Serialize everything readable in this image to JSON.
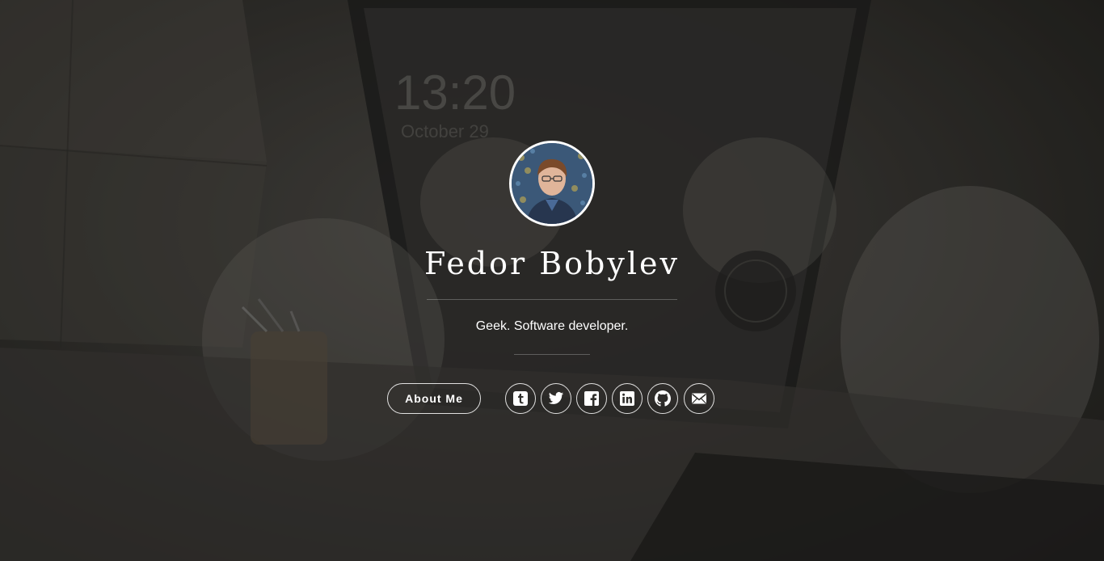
{
  "profile": {
    "name": "Fedor Bobylev",
    "tagline": "Geek. Software developer."
  },
  "actions": {
    "about_label": "About Me"
  },
  "social_links": [
    {
      "icon": "tumblr-icon"
    },
    {
      "icon": "twitter-icon"
    },
    {
      "icon": "facebook-icon"
    },
    {
      "icon": "linkedin-icon"
    },
    {
      "icon": "github-icon"
    },
    {
      "icon": "email-icon"
    }
  ],
  "colors": {
    "text": "#ffffff",
    "background": "#2a2926"
  }
}
